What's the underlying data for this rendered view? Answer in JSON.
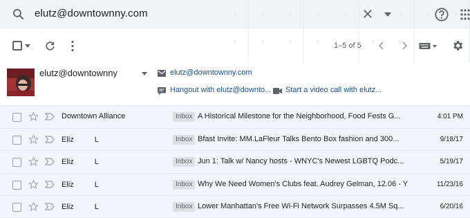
{
  "search": {
    "query": "elutz@downtownny.com"
  },
  "toolbar": {
    "range": "1–5 of 5"
  },
  "contact": {
    "name": "elutz@downtownny",
    "email": "elutz@downtownny.com",
    "hangout": "Hangout with elutz@downto...",
    "video": "Start a video call with elutz..."
  },
  "emails": [
    {
      "sender": "Downtown Alliance",
      "label": "Inbox",
      "subject": "A Historical Milestone for the Neighborhood, Food Fests G...",
      "date": "4:01 PM"
    },
    {
      "sender": "Eliz",
      "sender_tail": "L",
      "label": "Inbox",
      "subject": "Bfast Invite: MM.LaFleur Talks Bento Box fashion and 300...",
      "date": "9/18/17"
    },
    {
      "sender": "Eliz",
      "sender_tail": "L",
      "label": "Inbox",
      "subject": "Jun 1: Talk w/ Nancy hosts - WNYC's Newest LGBTQ Podc...",
      "date": "5/19/17"
    },
    {
      "sender": "Eliz",
      "sender_tail": "L",
      "label": "Inbox",
      "subject": "Why We Need Women's Clubs feat. Audrey Gelman, 12.06 - Y",
      "date": "11/23/16"
    },
    {
      "sender": "Eliz",
      "sender_tail": "L",
      "label": "Inbox",
      "subject": "Lower Manhattan's Free Wi-Fi Network Surpasses 4.5M Sq...",
      "date": "6/20/16"
    }
  ],
  "colors": {
    "link": "#1a4fa3",
    "row_bg": "#f2f6fc",
    "badge_bg": "#dddfe2"
  }
}
